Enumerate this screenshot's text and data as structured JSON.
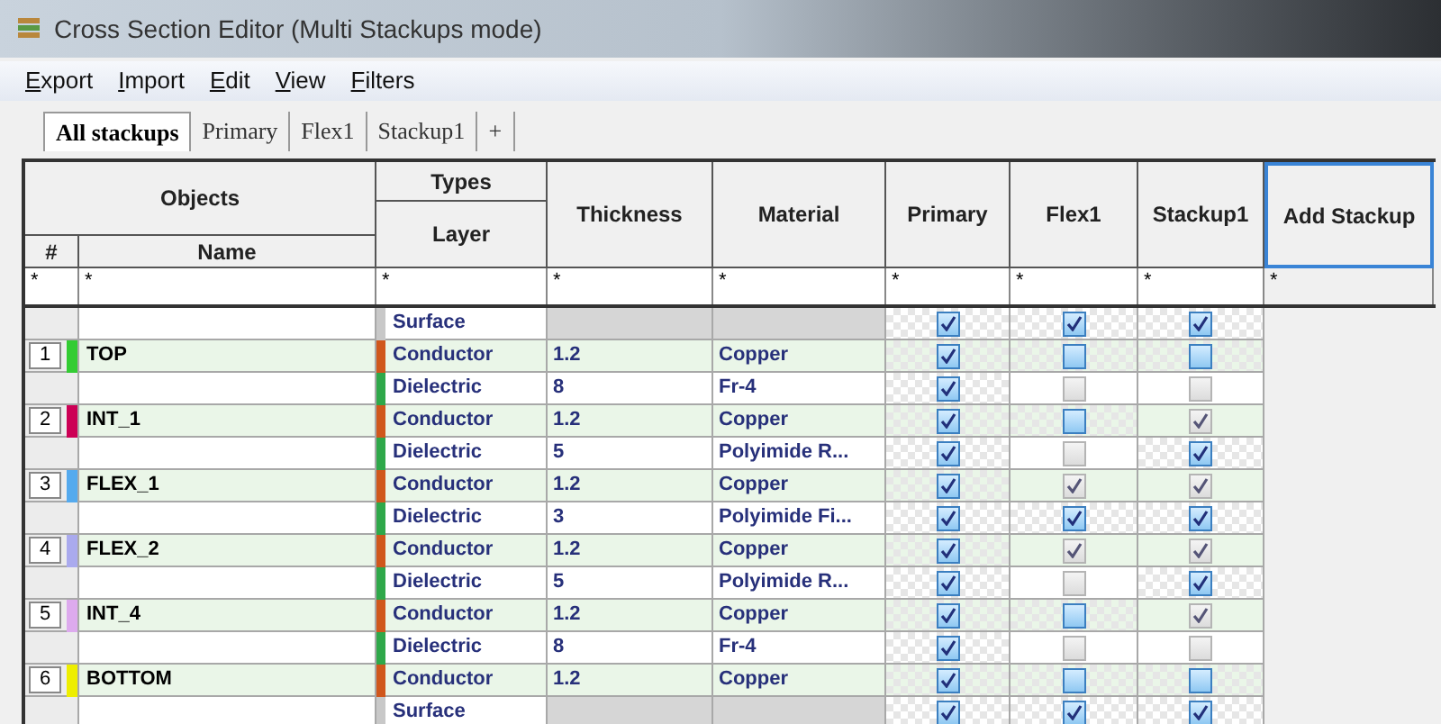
{
  "window": {
    "title": "Cross Section Editor (Multi Stackups mode)"
  },
  "menu": [
    "Export",
    "Import",
    "Edit",
    "View",
    "Filters"
  ],
  "tabs": [
    {
      "label": "All stackups",
      "selected": true
    },
    {
      "label": "Primary",
      "selected": false
    },
    {
      "label": "Flex1",
      "selected": false
    },
    {
      "label": "Stackup1",
      "selected": false
    },
    {
      "label": "+",
      "selected": false
    }
  ],
  "table": {
    "header": {
      "objects": "Objects",
      "number": "#",
      "name": "Name",
      "types": "Types",
      "layer": "Layer",
      "thickness": "Thickness",
      "material": "Material",
      "stackups": [
        "Primary",
        "Flex1",
        "Stackup1"
      ],
      "add_stackup": "Add Stackup"
    },
    "filters": [
      "*",
      "*",
      "*",
      "*",
      "*",
      "*",
      "*",
      "*",
      "*"
    ],
    "rows": [
      {
        "kind": "surface",
        "layer": "Surface",
        "stackups": [
          {
            "checked": true,
            "disabled": false
          },
          {
            "checked": true,
            "disabled": false
          },
          {
            "checked": true,
            "disabled": false
          }
        ]
      },
      {
        "kind": "conductor",
        "number": "1",
        "name": "TOP",
        "color": "#33cc33",
        "layer": "Conductor",
        "thickness": "1.2",
        "material": "Copper",
        "stackups": [
          {
            "checked": true,
            "disabled": false
          },
          {
            "checked": false,
            "disabled": false
          },
          {
            "checked": false,
            "disabled": false
          }
        ]
      },
      {
        "kind": "dielectric",
        "layer": "Dielectric",
        "thickness": "8",
        "material": "Fr-4",
        "stackups": [
          {
            "checked": true,
            "disabled": false
          },
          {
            "checked": false,
            "disabled": true
          },
          {
            "checked": false,
            "disabled": true
          }
        ]
      },
      {
        "kind": "conductor",
        "number": "2",
        "name": "INT_1",
        "color": "#cc0055",
        "layer": "Conductor",
        "thickness": "1.2",
        "material": "Copper",
        "stackups": [
          {
            "checked": true,
            "disabled": false
          },
          {
            "checked": false,
            "disabled": false
          },
          {
            "checked": true,
            "disabled": true
          }
        ]
      },
      {
        "kind": "dielectric",
        "layer": "Dielectric",
        "thickness": "5",
        "material": "Polyimide R...",
        "stackups": [
          {
            "checked": true,
            "disabled": false
          },
          {
            "checked": false,
            "disabled": true
          },
          {
            "checked": true,
            "disabled": false
          }
        ]
      },
      {
        "kind": "conductor",
        "number": "3",
        "name": "FLEX_1",
        "color": "#55aaee",
        "layer": "Conductor",
        "thickness": "1.2",
        "material": "Copper",
        "stackups": [
          {
            "checked": true,
            "disabled": false
          },
          {
            "checked": true,
            "disabled": true
          },
          {
            "checked": true,
            "disabled": true
          }
        ]
      },
      {
        "kind": "dielectric",
        "layer": "Dielectric",
        "thickness": "3",
        "material": "Polyimide Fi...",
        "stackups": [
          {
            "checked": true,
            "disabled": false
          },
          {
            "checked": true,
            "disabled": false
          },
          {
            "checked": true,
            "disabled": false
          }
        ]
      },
      {
        "kind": "conductor",
        "number": "4",
        "name": "FLEX_2",
        "color": "#aaaaee",
        "layer": "Conductor",
        "thickness": "1.2",
        "material": "Copper",
        "stackups": [
          {
            "checked": true,
            "disabled": false
          },
          {
            "checked": true,
            "disabled": true
          },
          {
            "checked": true,
            "disabled": true
          }
        ]
      },
      {
        "kind": "dielectric",
        "layer": "Dielectric",
        "thickness": "5",
        "material": "Polyimide R...",
        "stackups": [
          {
            "checked": true,
            "disabled": false
          },
          {
            "checked": false,
            "disabled": true
          },
          {
            "checked": true,
            "disabled": false
          }
        ]
      },
      {
        "kind": "conductor",
        "number": "5",
        "name": "INT_4",
        "color": "#ddaaee",
        "layer": "Conductor",
        "thickness": "1.2",
        "material": "Copper",
        "stackups": [
          {
            "checked": true,
            "disabled": false
          },
          {
            "checked": false,
            "disabled": false
          },
          {
            "checked": true,
            "disabled": true
          }
        ]
      },
      {
        "kind": "dielectric",
        "layer": "Dielectric",
        "thickness": "8",
        "material": "Fr-4",
        "stackups": [
          {
            "checked": true,
            "disabled": false
          },
          {
            "checked": false,
            "disabled": true
          },
          {
            "checked": false,
            "disabled": true
          }
        ]
      },
      {
        "kind": "conductor",
        "number": "6",
        "name": "BOTTOM",
        "color": "#eeee00",
        "layer": "Conductor",
        "thickness": "1.2",
        "material": "Copper",
        "stackups": [
          {
            "checked": true,
            "disabled": false
          },
          {
            "checked": false,
            "disabled": false
          },
          {
            "checked": false,
            "disabled": false
          }
        ]
      },
      {
        "kind": "surface",
        "layer": "Surface",
        "stackups": [
          {
            "checked": true,
            "disabled": false
          },
          {
            "checked": true,
            "disabled": false
          },
          {
            "checked": true,
            "disabled": false
          }
        ]
      }
    ]
  }
}
